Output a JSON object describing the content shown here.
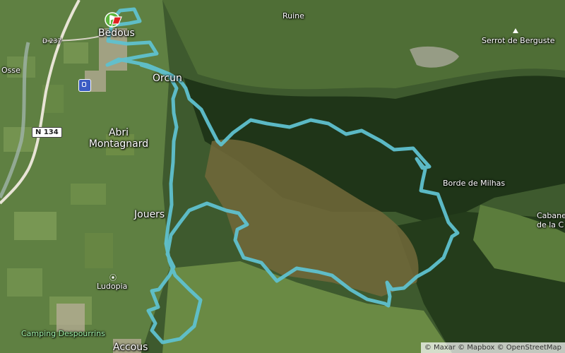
{
  "map": {
    "style": "satellite",
    "route_color": "#5fc1cf",
    "labels": {
      "bedous": "Bedous",
      "ruine": "Ruine",
      "serrot": "Serrot de Berguste",
      "osse": "Osse",
      "orcun": "Orcun",
      "abri_line1": "Abri",
      "abri_line2": "Montagnard",
      "borde": "Borde de Milhas",
      "jouers": "Jouers",
      "cabane_line1": "Cabane",
      "cabane_line2": "de la C",
      "ludopia": "Ludopia",
      "camping": "Camping Despourrins",
      "accous": "Accous",
      "d_road": "D 237"
    },
    "road_shield": "N 134",
    "icons": {
      "rail": "train-station-icon",
      "peak": "mountain-peak-icon",
      "poi": "place-pin-icon",
      "start": "start-flag-icon",
      "finish": "finish-flag-icon"
    },
    "attribution": "© Maxar © Mapbox © OpenStreetMap"
  }
}
